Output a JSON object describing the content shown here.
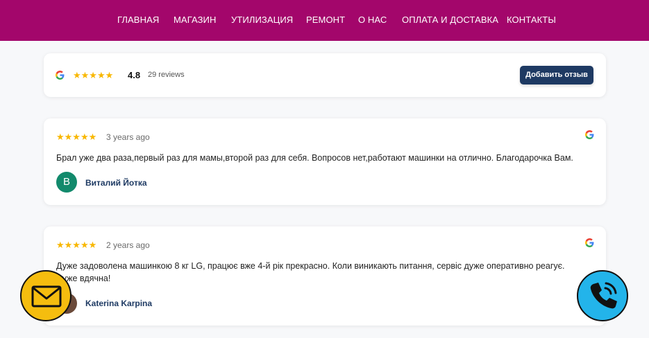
{
  "nav": {
    "items": [
      "ГЛАВНАЯ",
      "МАГАЗИН",
      "УТИЛИЗАЦИЯ",
      "РЕМОНТ",
      "О НАС",
      "ОПЛАТА И ДОСТАВКА",
      "КОНТАКТЫ"
    ]
  },
  "summary": {
    "stars": "★★★★★",
    "rating": "4.8",
    "reviews_count": "29 reviews",
    "add_review_label": "Добавить отзыв"
  },
  "reviews": [
    {
      "stars": "★★★★★",
      "time": "3 years ago",
      "text": "Брал уже два раза,первый раз для мамы,второй раз для себя. Вопросов нет,работают машинки на отлично. Благодарочка Вам.",
      "avatar_letter": "В",
      "author": "Виталий Йотка"
    },
    {
      "stars": "★★★★★",
      "time": "2 years ago",
      "text": "Дуже задоволена машинкою 8 кг LG, працює вже 4-й рік прекрасно. Коли виникають питання, сервіс дуже оперативно реагує. Дуже вдячна!",
      "avatar_letter": "",
      "author": "Katerina Karpina"
    }
  ],
  "colors": {
    "nav_bg": "#a3066b",
    "button_bg": "#1e3a63",
    "star": "#f8b700",
    "avatar_green": "#128a6c",
    "mail_fab": "#f5bd0f",
    "phone_fab": "#23b4ea"
  },
  "icons": {
    "google": "google-icon",
    "mail": "envelope-icon",
    "phone": "phone-icon"
  }
}
